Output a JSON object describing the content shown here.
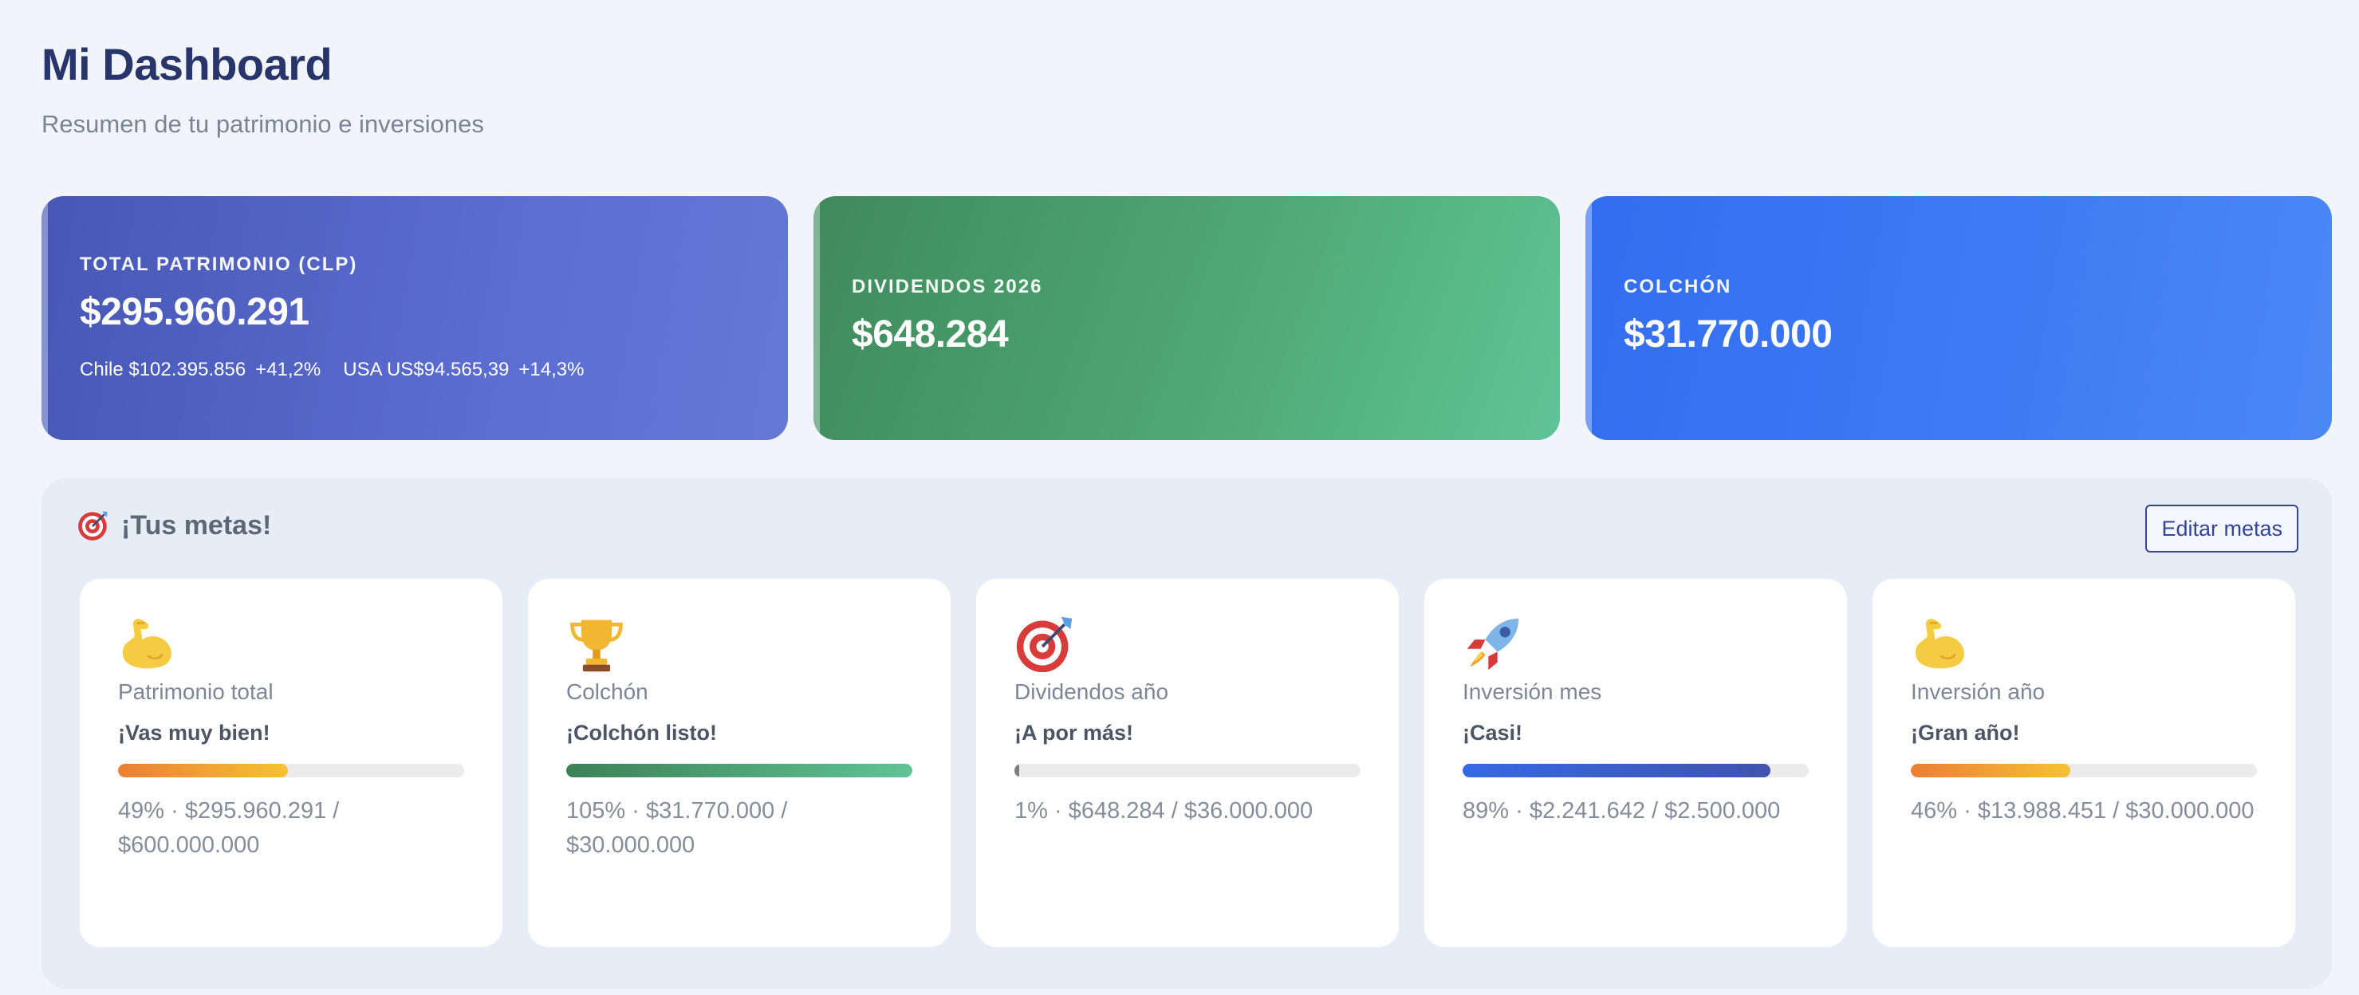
{
  "header": {
    "title": "Mi Dashboard",
    "subtitle": "Resumen de tu patrimonio e inversiones"
  },
  "stats": {
    "patrimonio": {
      "label": "TOTAL PATRIMONIO (CLP)",
      "value": "$295.960.291",
      "chile_label": "Chile $102.395.856",
      "chile_change": "+41,2%",
      "usa_label": "USA US$94.565,39",
      "usa_change": "+14,3%"
    },
    "dividendos": {
      "label": "DIVIDENDOS 2026",
      "value": "$648.284"
    },
    "colchon": {
      "label": "COLCHÓN",
      "value": "$31.770.000"
    }
  },
  "goals": {
    "title": "¡Tus metas!",
    "title_icon": "target-icon",
    "edit_label": "Editar metas",
    "items": [
      {
        "icon": "flexed-biceps-icon",
        "name": "Patrimonio total",
        "message": "¡Vas muy bien!",
        "progress": 49,
        "fill": "orange",
        "detail": "49% · $295.960.291 / $600.000.000"
      },
      {
        "icon": "trophy-icon",
        "name": "Colchón",
        "message": "¡Colchón listo!",
        "progress": 105,
        "fill": "green",
        "detail": "105% · $31.770.000 / $30.000.000"
      },
      {
        "icon": "target-icon",
        "name": "Dividendos año",
        "message": "¡A por más!",
        "progress": 1,
        "fill": "gray",
        "detail": "1% · $648.284 / $36.000.000"
      },
      {
        "icon": "rocket-icon",
        "name": "Inversión mes",
        "message": "¡Casi!",
        "progress": 89,
        "fill": "blue",
        "detail": "89% · $2.241.642 / $2.500.000"
      },
      {
        "icon": "flexed-biceps-icon",
        "name": "Inversión año",
        "message": "¡Gran año!",
        "progress": 46,
        "fill": "orange",
        "detail": "46% · $13.988.451 / $30.000.000"
      }
    ]
  }
}
